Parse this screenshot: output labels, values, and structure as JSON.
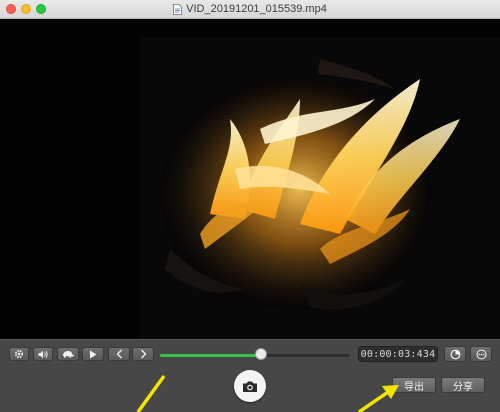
{
  "window": {
    "title": "VID_20191201_015539.mp4",
    "title_icon": "document-icon"
  },
  "player": {
    "timecode": "00:00:03:434",
    "progress": 0.53,
    "accent_color": "#38c24a"
  },
  "controls": {
    "settings_icon": "gear-icon",
    "volume_icon": "speaker-icon",
    "speed_icon": "turtle-icon",
    "play_icon": "play-icon",
    "prev_icon": "chevron-left-icon",
    "next_icon": "chevron-right-icon",
    "rotate_icon": "rotate-icon",
    "more_icon": "ellipsis-icon",
    "snapshot_icon": "camera-icon"
  },
  "actions": {
    "export_label": "导出",
    "share_label": "分享"
  },
  "annotations": {
    "arrow_color": "#f2e600"
  }
}
